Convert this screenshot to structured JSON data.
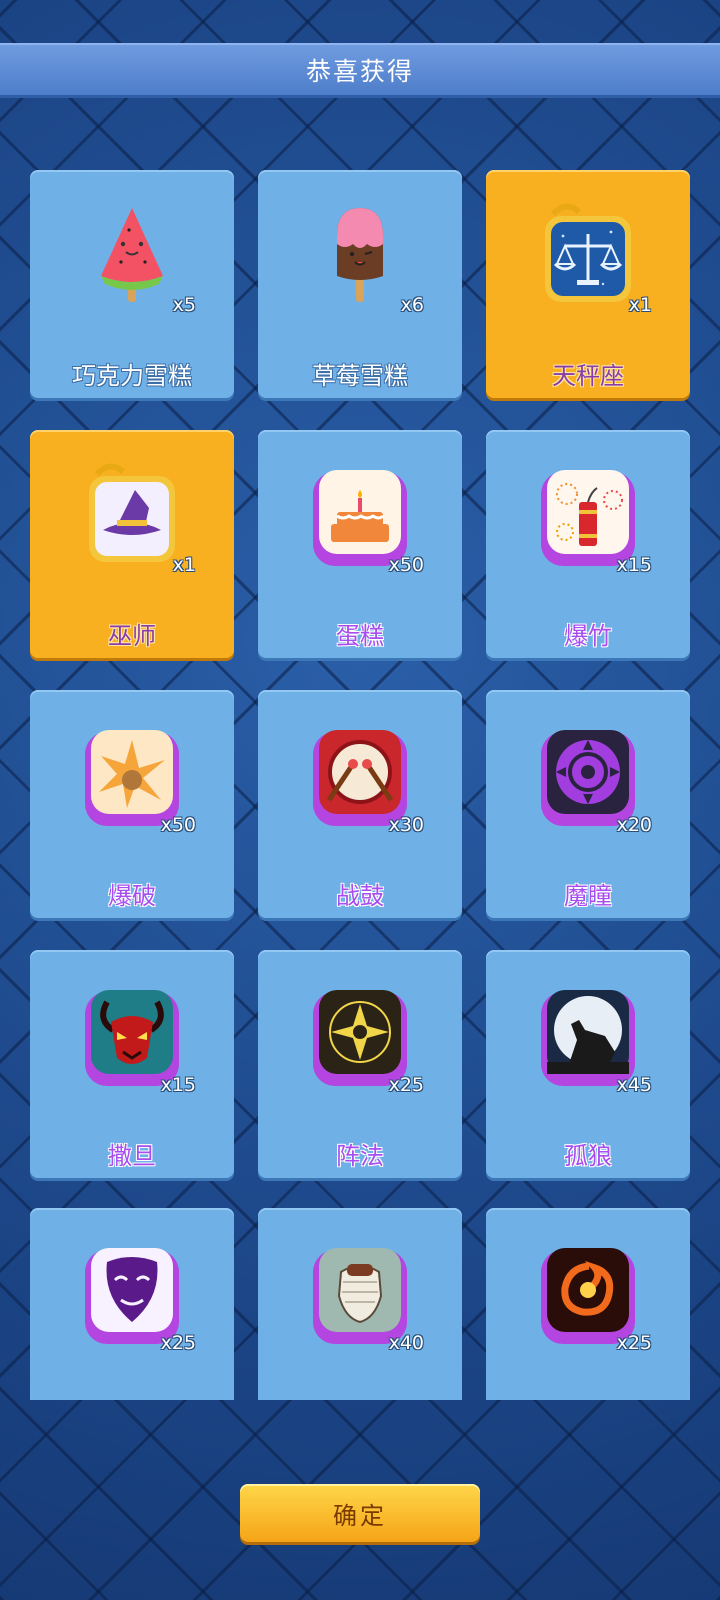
{
  "header": {
    "title": "恭喜获得"
  },
  "items": [
    {
      "name": "巧克力雪糕",
      "qty": "x5",
      "icon": "watermelon-popsicle-icon",
      "highlight": false
    },
    {
      "name": "草莓雪糕",
      "qty": "x6",
      "icon": "strawberry-popsicle-icon",
      "highlight": false
    },
    {
      "name": "天秤座",
      "qty": "x1",
      "icon": "libra-icon",
      "highlight": true
    },
    {
      "name": "巫师",
      "qty": "x1",
      "icon": "wizard-hat-icon",
      "highlight": true
    },
    {
      "name": "蛋糕",
      "qty": "x50",
      "icon": "cake-icon",
      "highlight": false
    },
    {
      "name": "爆竹",
      "qty": "x15",
      "icon": "firecracker-icon",
      "highlight": false
    },
    {
      "name": "爆破",
      "qty": "x50",
      "icon": "explosion-icon",
      "highlight": false
    },
    {
      "name": "战鼓",
      "qty": "x30",
      "icon": "war-drum-icon",
      "highlight": false
    },
    {
      "name": "魔瞳",
      "qty": "x20",
      "icon": "magic-eye-icon",
      "highlight": false
    },
    {
      "name": "撒旦",
      "qty": "x15",
      "icon": "demon-icon",
      "highlight": false
    },
    {
      "name": "阵法",
      "qty": "x25",
      "icon": "magic-circle-icon",
      "highlight": false
    },
    {
      "name": "孤狼",
      "qty": "x45",
      "icon": "howling-wolf-icon",
      "highlight": false
    },
    {
      "name": "",
      "qty": "x25",
      "icon": "mask-icon",
      "highlight": false
    },
    {
      "name": "",
      "qty": "x40",
      "icon": "bandaged-fist-icon",
      "highlight": false
    },
    {
      "name": "",
      "qty": "x25",
      "icon": "fire-vortex-icon",
      "highlight": false
    }
  ],
  "footer": {
    "confirm_label": "确定"
  },
  "colors": {
    "card": "#6fb1e6",
    "card_highlight": "#f9b020",
    "accent_purple": "#b445e0"
  }
}
